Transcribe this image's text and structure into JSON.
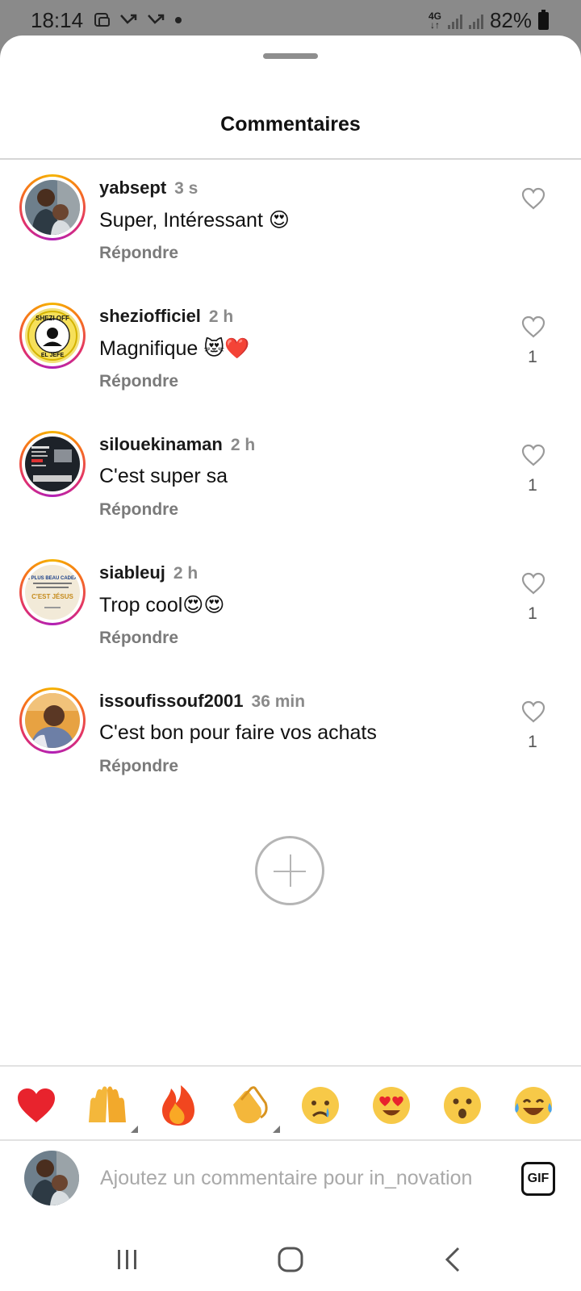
{
  "status_bar": {
    "time": "18:14",
    "network": "4G",
    "battery": "82%"
  },
  "sheet": {
    "title": "Commentaires"
  },
  "comments": [
    {
      "username": "yabsept",
      "time": "3 s",
      "text": "Super, Intéressant 😍",
      "reply": "Répondre",
      "likes": ""
    },
    {
      "username": "sheziofficiel",
      "time": "2 h",
      "text": "Magnifique 😻❤️",
      "reply": "Répondre",
      "likes": "1"
    },
    {
      "username": "silouekinaman",
      "time": "2 h",
      "text": "C'est super sa",
      "reply": "Répondre",
      "likes": "1"
    },
    {
      "username": "siableuj",
      "time": "2 h",
      "text": "Trop cool😍😍",
      "reply": "Répondre",
      "likes": "1"
    },
    {
      "username": "issoufissouf2001",
      "time": "36 min",
      "text": "C'est bon pour faire vos achats",
      "reply": "Répondre",
      "likes": "1"
    }
  ],
  "avatar_lettering": {
    "sheziofficiel": "SHEZI OFF EL JEFE",
    "siableuj": "LE PLUS BEAU CADEAU C'EST JÉSUS"
  },
  "emoji_bar": [
    "heart",
    "raising-hands",
    "fire",
    "clapping-hands",
    "crying-face",
    "heart-eyes-face",
    "surprised-face",
    "tears-of-joy-face"
  ],
  "input": {
    "placeholder": "Ajoutez un commentaire pour in_novation",
    "gif_label": "GIF"
  },
  "colors": {
    "accent_ring": "#e1306c",
    "like_icon": "#9a9a9a",
    "heart_red": "#e8232d"
  }
}
